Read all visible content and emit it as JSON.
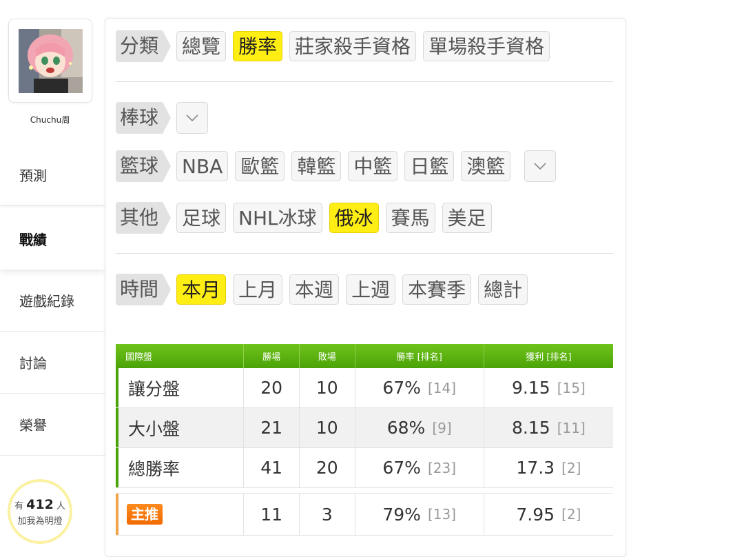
{
  "user": {
    "name": "Chuchu周"
  },
  "nav": [
    {
      "label": "預測"
    },
    {
      "label": "戰績"
    },
    {
      "label": "遊戲紀錄"
    },
    {
      "label": "討論"
    },
    {
      "label": "榮譽"
    }
  ],
  "fans": {
    "prefix": "有",
    "count": "412",
    "suffix": "人",
    "cta": "加我為明燈"
  },
  "category": {
    "label": "分類",
    "items": [
      "總覽",
      "勝率",
      "莊家殺手資格",
      "單場殺手資格"
    ],
    "selected": "勝率"
  },
  "baseball": {
    "label": "棒球"
  },
  "basketball": {
    "label": "籃球",
    "items": [
      "NBA",
      "歐籃",
      "韓籃",
      "中籃",
      "日籃",
      "澳籃"
    ]
  },
  "other": {
    "label": "其他",
    "items": [
      "足球",
      "NHL冰球",
      "俄冰",
      "賽馬",
      "美足"
    ],
    "selected": "俄冰"
  },
  "time": {
    "label": "時間",
    "items": [
      "本月",
      "上月",
      "本週",
      "上週",
      "本賽季",
      "總計"
    ],
    "selected": "本月"
  },
  "table": {
    "headers": [
      "國際盤",
      "勝場",
      "敗場",
      "勝率 [排名]",
      "獲利 [排名]"
    ],
    "rows": [
      {
        "name": "讓分盤",
        "wins": "20",
        "losses": "10",
        "rate": "67%",
        "rate_rank": "[14]",
        "profit": "9.15",
        "profit_rank": "[15]"
      },
      {
        "name": "大小盤",
        "wins": "21",
        "losses": "10",
        "rate": "68%",
        "rate_rank": "[9]",
        "profit": "8.15",
        "profit_rank": "[11]"
      },
      {
        "name": "總勝率",
        "wins": "41",
        "losses": "20",
        "rate": "67%",
        "rate_rank": "[23]",
        "profit": "17.3",
        "profit_rank": "[2]"
      }
    ],
    "main": {
      "badge": "主推",
      "wins": "11",
      "losses": "3",
      "rate": "79%",
      "rate_rank": "[13]",
      "profit": "7.95",
      "profit_rank": "[2]"
    }
  },
  "colors": {
    "accent_yellow": "#ffee13",
    "table_green": "#4aa308",
    "badge_orange": "#f06a00"
  }
}
